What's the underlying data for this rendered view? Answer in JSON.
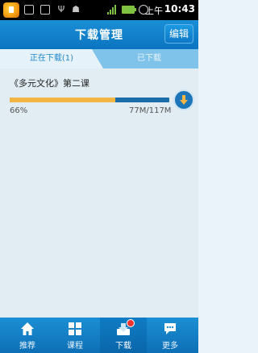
{
  "status_bar": {
    "ampm": "上午",
    "time": "10:43"
  },
  "header": {
    "title": "下载管理",
    "edit_label": "编辑"
  },
  "tabs": [
    {
      "label": "正在下载(1)",
      "active": true
    },
    {
      "label": "已下载",
      "active": false
    }
  ],
  "downloads": [
    {
      "title": "《多元文化》第二课",
      "progress_percent": 66,
      "percent_label": "66%",
      "size_label": "77M/117M"
    }
  ],
  "bottom_nav": [
    {
      "label": "推荐",
      "icon": "home-icon",
      "active": false
    },
    {
      "label": "课程",
      "icon": "grid-icon",
      "active": false
    },
    {
      "label": "下载",
      "icon": "download-tray-icon",
      "active": true,
      "badge": true
    },
    {
      "label": "更多",
      "icon": "chat-bubble-icon",
      "active": false
    }
  ],
  "colors": {
    "header_blue": "#0b74c0",
    "progress_fill": "#f3b543",
    "progress_track": "#1a6da8",
    "active_tab_text": "#1f87cb"
  }
}
